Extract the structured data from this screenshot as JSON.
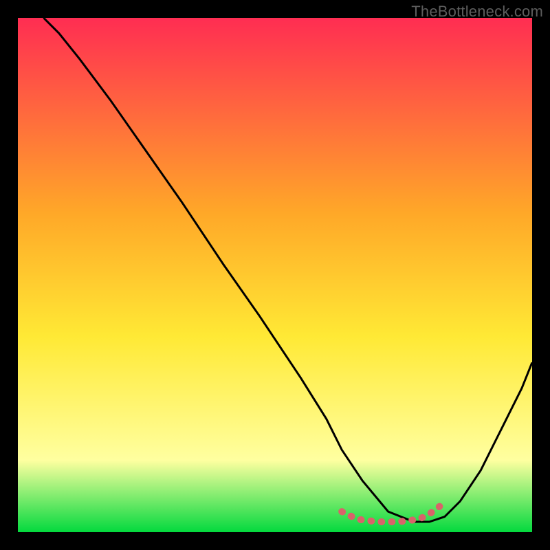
{
  "watermark": "TheBottleneck.com",
  "chart_data": {
    "type": "line",
    "title": "",
    "xlabel": "",
    "ylabel": "",
    "xlim": [
      0,
      100
    ],
    "ylim": [
      0,
      100
    ],
    "gradient": {
      "top": "#ff2d52",
      "mid_upper": "#ffa828",
      "mid": "#ffe935",
      "mid_lower": "#ffffa0",
      "bottom": "#03d93e"
    },
    "series": [
      {
        "name": "curve",
        "color": "#000000",
        "stroke_width": 3,
        "x": [
          5,
          8,
          12,
          18,
          25,
          32,
          40,
          47,
          55,
          60,
          63,
          67,
          72,
          77,
          80,
          83,
          86,
          90,
          94,
          98,
          100
        ],
        "y": [
          100,
          97,
          92,
          84,
          74,
          64,
          52,
          42,
          30,
          22,
          16,
          10,
          4,
          2,
          2,
          3,
          6,
          12,
          20,
          28,
          33
        ]
      },
      {
        "name": "valley-highlight",
        "color": "#d9636a",
        "stroke_width": 10,
        "x": [
          63,
          66,
          70,
          74,
          78,
          80,
          82
        ],
        "y": [
          4,
          2.5,
          2,
          2,
          2.5,
          3.5,
          5
        ]
      }
    ]
  }
}
